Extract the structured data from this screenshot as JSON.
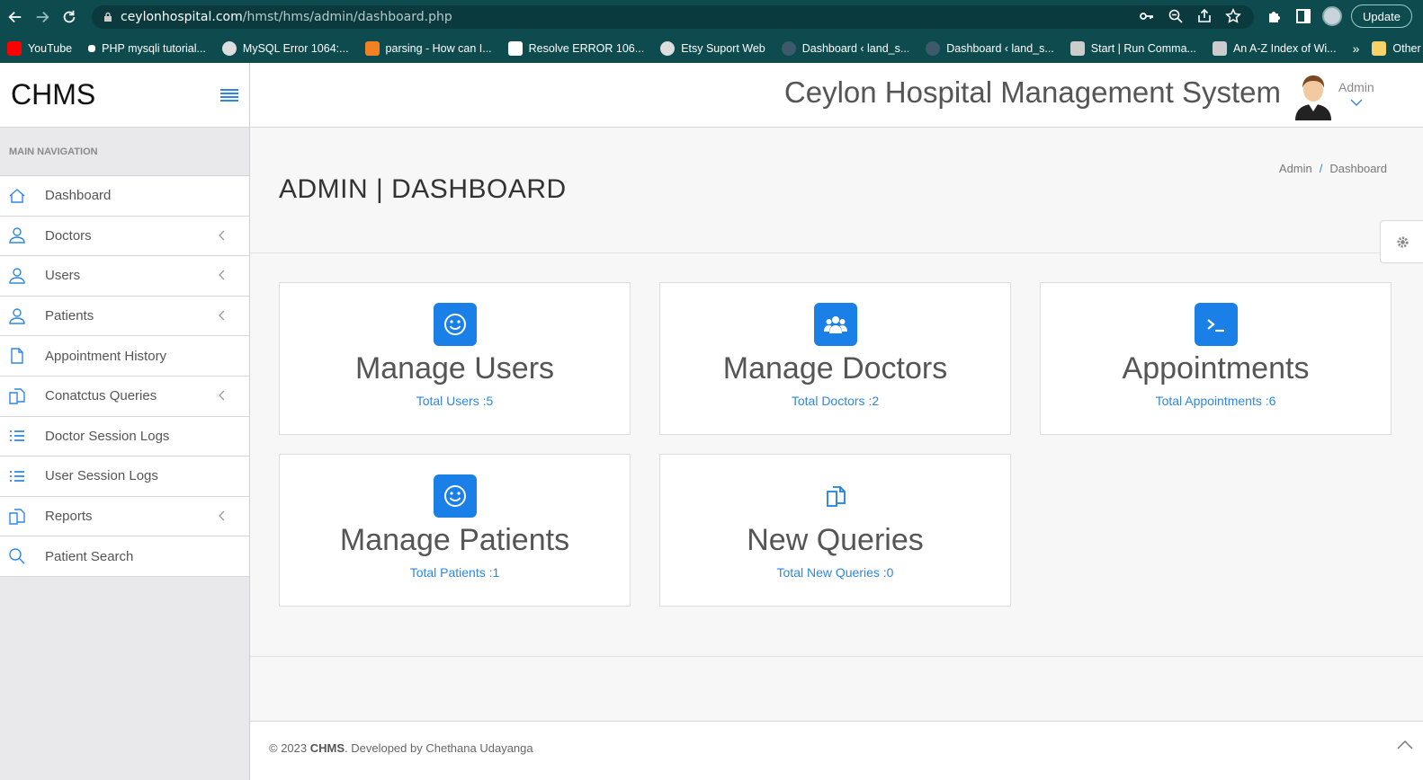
{
  "browser": {
    "url_host": "ceylonhospital.com",
    "url_path": "/hmst/hms/admin/dashboard.php",
    "update_label": "Update",
    "bookmarks": [
      {
        "label": "YouTube",
        "color": "#ff0000"
      },
      {
        "label": "PHP mysqli tutorial...",
        "color": "#ffffff"
      },
      {
        "label": "MySQL Error 1064:...",
        "color": "#dddddd"
      },
      {
        "label": "parsing - How can I...",
        "color": "#f48024"
      },
      {
        "label": "Resolve ERROR 106...",
        "color": "#ffffff"
      },
      {
        "label": "Etsy Suport Web",
        "color": "#dddddd"
      },
      {
        "label": "Dashboard ‹ land_s...",
        "color": "#3c5a6a"
      },
      {
        "label": "Dashboard ‹ land_s...",
        "color": "#3c5a6a"
      },
      {
        "label": "Start | Run Comma...",
        "color": "#cccccc"
      },
      {
        "label": "An A-Z Index of Wi...",
        "color": "#cccccc"
      }
    ],
    "more_label": "»",
    "other_bookmarks": "Other bookmarks"
  },
  "sidebar": {
    "brand": "CHMS",
    "heading": "MAIN NAVIGATION",
    "items": [
      {
        "label": "Dashboard",
        "icon": "home-icon",
        "submenu": false
      },
      {
        "label": "Doctors",
        "icon": "user-icon",
        "submenu": true
      },
      {
        "label": "Users",
        "icon": "user-icon",
        "submenu": true
      },
      {
        "label": "Patients",
        "icon": "user-icon",
        "submenu": true
      },
      {
        "label": "Appointment History",
        "icon": "file-icon",
        "submenu": false
      },
      {
        "label": "Conatctus Queries",
        "icon": "files-icon",
        "submenu": true
      },
      {
        "label": "Doctor Session Logs",
        "icon": "list-icon",
        "submenu": false
      },
      {
        "label": "User Session Logs",
        "icon": "list-icon",
        "submenu": false
      },
      {
        "label": "Reports",
        "icon": "files-icon",
        "submenu": true
      },
      {
        "label": "Patient Search",
        "icon": "search-icon",
        "submenu": false
      }
    ]
  },
  "header": {
    "system_title": "Ceylon Hospital Management System",
    "user_label": "Admin"
  },
  "page": {
    "title": "ADMIN | DASHBOARD",
    "breadcrumb": [
      "Admin",
      "Dashboard"
    ]
  },
  "cards": [
    {
      "title": "Manage Users",
      "subtitle": "Total Users :5",
      "icon": "smile-icon"
    },
    {
      "title": "Manage Doctors",
      "subtitle": "Total Doctors :2",
      "icon": "users-group-icon"
    },
    {
      "title": "Appointments",
      "subtitle": "Total Appointments :6",
      "icon": "terminal-icon"
    },
    {
      "title": "Manage Patients",
      "subtitle": "Total Patients :1",
      "icon": "smile-icon"
    },
    {
      "title": "New Queries",
      "subtitle": "Total New Queries :0",
      "icon": "files-icon"
    }
  ],
  "footer": {
    "prefix": "© 2023 ",
    "brand": "CHMS",
    "suffix": ". Developed by Chethana Udayanga"
  },
  "colors": {
    "accent": "#1a7fe6",
    "browser_chrome": "#0d4b4f"
  }
}
